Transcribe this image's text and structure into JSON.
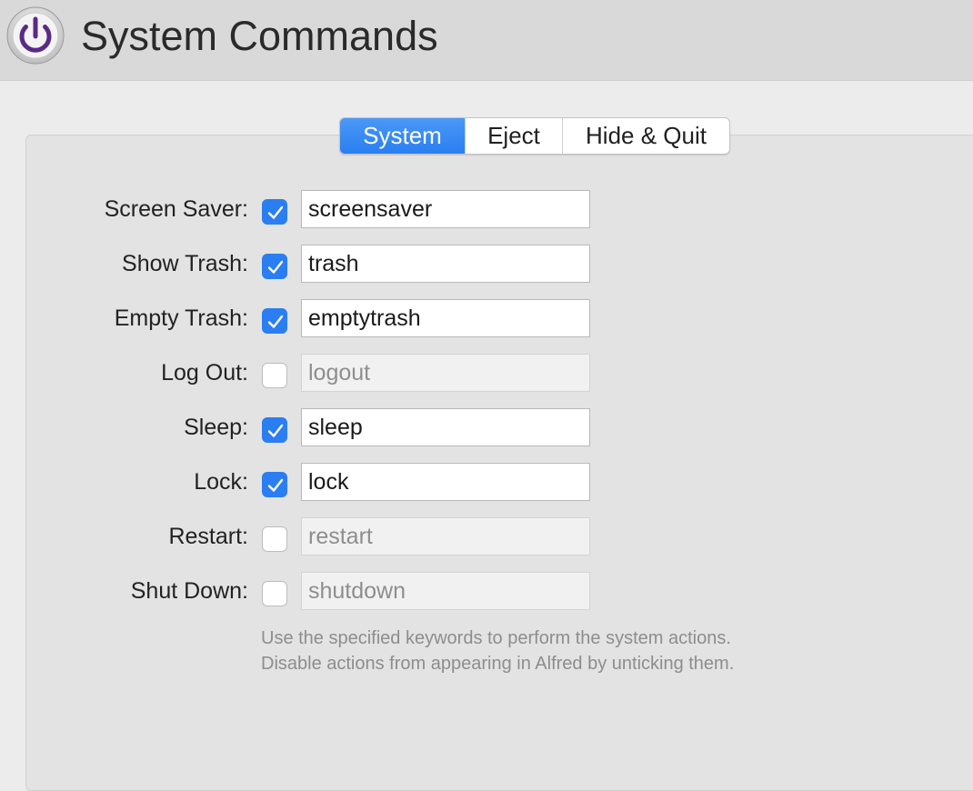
{
  "header": {
    "title": "System Commands",
    "icon": "power-icon",
    "icon_color": "#5b2a86"
  },
  "tabs": [
    {
      "label": "System",
      "active": true
    },
    {
      "label": "Eject",
      "active": false
    },
    {
      "label": "Hide & Quit",
      "active": false
    }
  ],
  "commands": [
    {
      "label": "Screen Saver:",
      "enabled": true,
      "keyword": "screensaver"
    },
    {
      "label": "Show Trash:",
      "enabled": true,
      "keyword": "trash"
    },
    {
      "label": "Empty Trash:",
      "enabled": true,
      "keyword": "emptytrash"
    },
    {
      "label": "Log Out:",
      "enabled": false,
      "keyword": "logout"
    },
    {
      "label": "Sleep:",
      "enabled": true,
      "keyword": "sleep"
    },
    {
      "label": "Lock:",
      "enabled": true,
      "keyword": "lock"
    },
    {
      "label": "Restart:",
      "enabled": false,
      "keyword": "restart"
    },
    {
      "label": "Shut Down:",
      "enabled": false,
      "keyword": "shutdown"
    }
  ],
  "help": {
    "line1": "Use the specified keywords to perform the system actions.",
    "line2": "Disable actions from appearing in Alfred by unticking them."
  },
  "colors": {
    "accent": "#2b7ef2",
    "header_bg": "#d9d9d9"
  }
}
